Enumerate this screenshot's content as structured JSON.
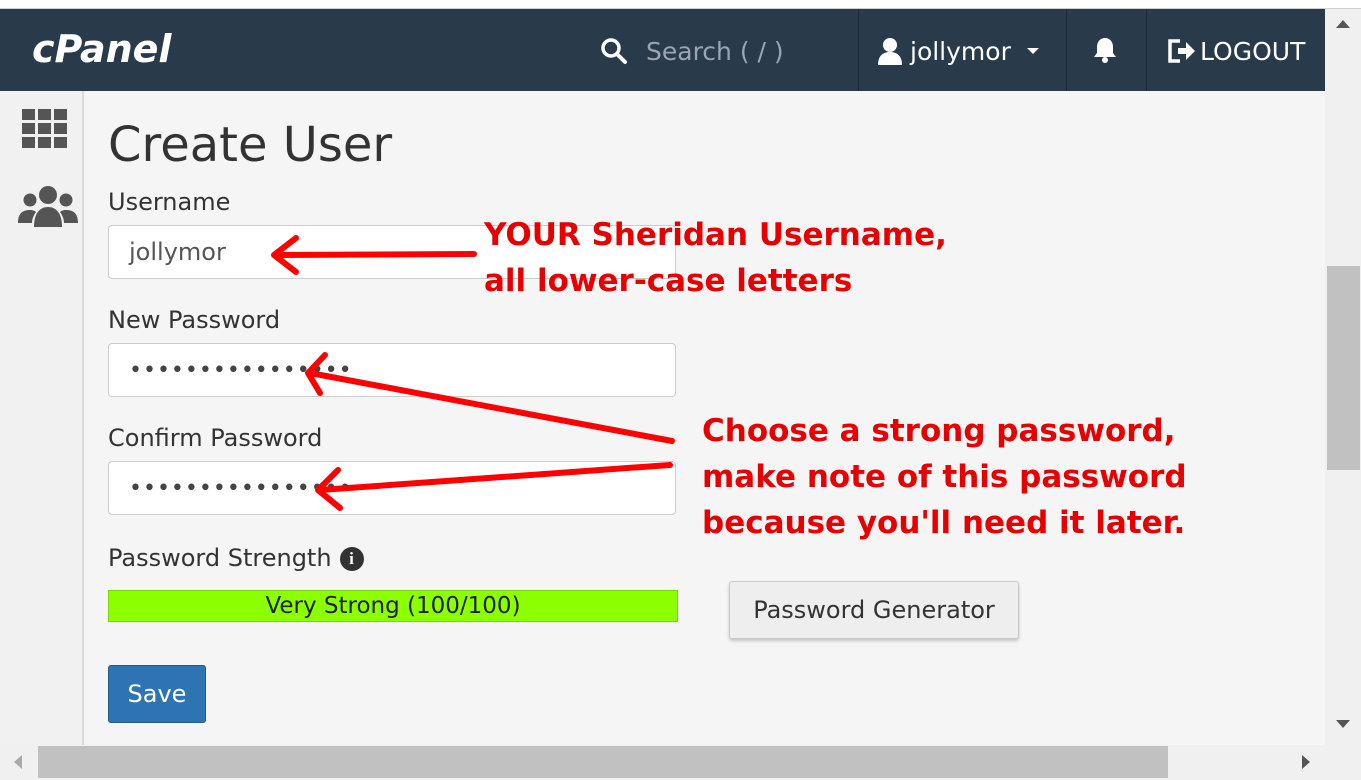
{
  "header": {
    "logo": "cPanel",
    "search_placeholder": "Search ( / )",
    "username": "jollymor",
    "logout_label": "LOGOUT"
  },
  "sidebar": {
    "items": [
      {
        "icon": "grid-icon"
      },
      {
        "icon": "users-icon"
      }
    ]
  },
  "form": {
    "title": "Create User",
    "username_label": "Username",
    "username_value": "jollymor",
    "new_password_label": "New Password",
    "new_password_value": "••••••••••••••••",
    "confirm_password_label": "Confirm Password",
    "confirm_password_value": "••••••••••••••••",
    "strength_label": "Password Strength",
    "strength_text": "Very Strong (100/100)",
    "strength_value": 100,
    "generator_label": "Password Generator",
    "save_label": "Save"
  },
  "annotations": {
    "username_note": [
      "YOUR Sheridan Username,",
      "all lower-case letters"
    ],
    "password_note": [
      "Choose a strong password,",
      "make note of this password",
      "because you'll need it later."
    ]
  },
  "colors": {
    "header_bg": "#293a4a",
    "annotation": "#e60000",
    "strength_bar": "#8cff00",
    "save_button": "#2e74b5"
  }
}
